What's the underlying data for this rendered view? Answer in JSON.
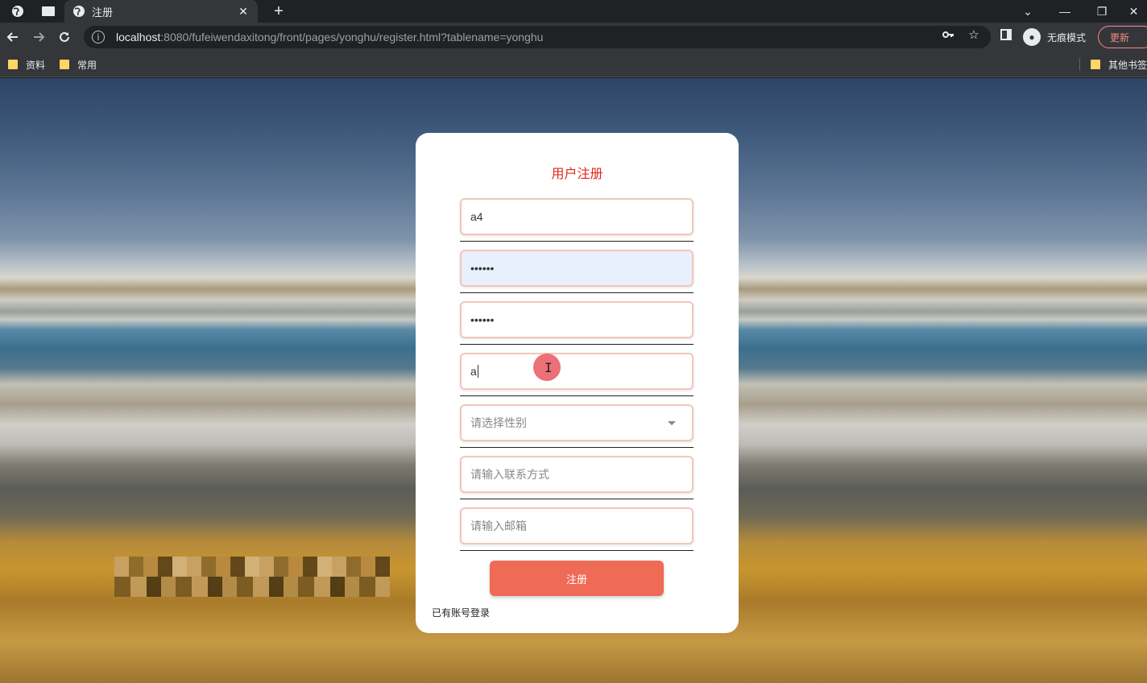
{
  "browser": {
    "tab": {
      "title": "注册",
      "close_glyph": "✕"
    },
    "new_tab_glyph": "+",
    "window_controls": {
      "dropdown": "⌄",
      "minimize": "—",
      "restore": "❐",
      "close": "✕"
    },
    "url": {
      "host": "localhost",
      "rest": ":8080/fufeiwendaxitong/front/pages/yonghu/register.html?tablename=yonghu"
    },
    "incognito_label": "无痕模式",
    "update_label": "更新",
    "bookmarks": [
      {
        "label": "资料"
      },
      {
        "label": "常用"
      }
    ],
    "other_bookmarks": "其他书签"
  },
  "form": {
    "title": "用户注册",
    "fields": [
      {
        "name": "username",
        "value": "a4",
        "placeholder": ""
      },
      {
        "name": "password",
        "value": "••••••",
        "placeholder": ""
      },
      {
        "name": "password_confirm",
        "value": "••••••",
        "placeholder": ""
      },
      {
        "name": "name",
        "value": "a",
        "placeholder": ""
      },
      {
        "name": "gender",
        "value": "",
        "placeholder": "请选择性别"
      },
      {
        "name": "phone",
        "value": "",
        "placeholder": "请输入联系方式"
      },
      {
        "name": "email",
        "value": "",
        "placeholder": "请输入邮箱"
      }
    ],
    "submit_label": "注册",
    "login_link": "已有账号登录"
  }
}
